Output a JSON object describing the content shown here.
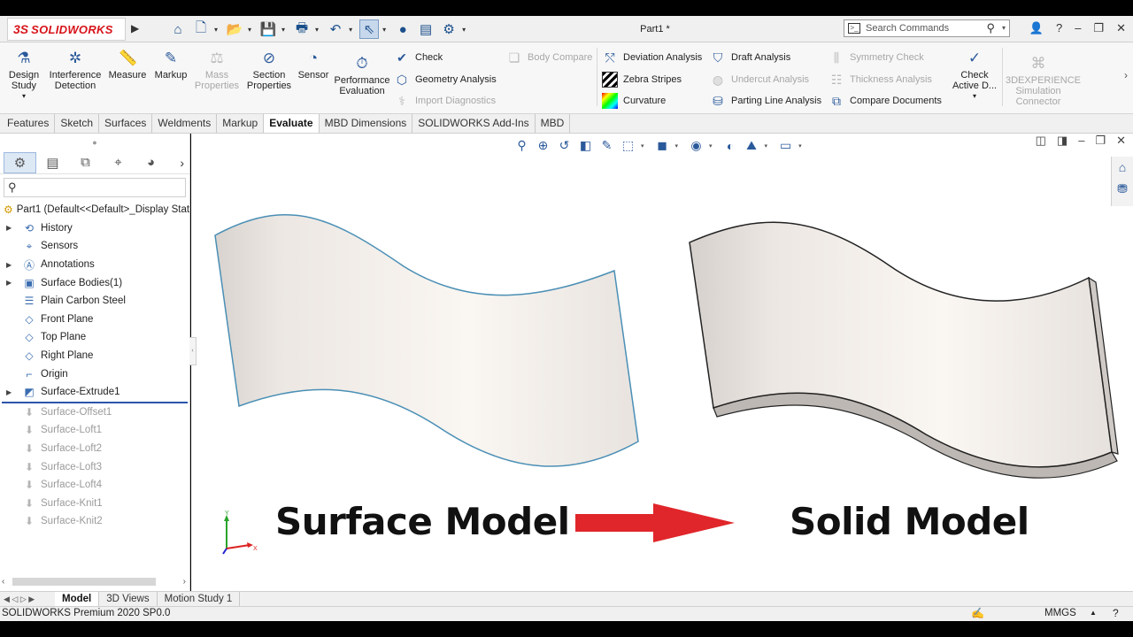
{
  "app": {
    "logo_prefix": "3S",
    "logo_text": "SOLIDWORKS",
    "document_title": "Part1 *",
    "search_placeholder": "Search Commands"
  },
  "ribbon": {
    "design_study": "Design Study",
    "interference": "Interference Detection",
    "measure": "Measure",
    "markup": "Markup",
    "mass_properties": "Mass Properties",
    "section_properties": "Section Properties",
    "sensor": "Sensor",
    "performance_evaluation": "Performance Evaluation",
    "check": "Check",
    "geometry_analysis": "Geometry Analysis",
    "import_diagnostics": "Import Diagnostics",
    "body_compare": "Body Compare",
    "deviation_analysis": "Deviation Analysis",
    "zebra_stripes": "Zebra Stripes",
    "curvature": "Curvature",
    "draft_analysis": "Draft Analysis",
    "undercut_analysis": "Undercut Analysis",
    "parting_line_analysis": "Parting Line Analysis",
    "symmetry_check": "Symmetry Check",
    "thickness_analysis": "Thickness Analysis",
    "compare_documents": "Compare Documents",
    "check_active": "Check Active D...",
    "simulation_connector": "3DEXPERIENCE Simulation Connector"
  },
  "tabs": [
    "Features",
    "Sketch",
    "Surfaces",
    "Weldments",
    "Markup",
    "Evaluate",
    "MBD Dimensions",
    "SOLIDWORKS Add-Ins",
    "MBD"
  ],
  "active_tab": "Evaluate",
  "tree": {
    "root": "Part1  (Default<<Default>_Display Stat",
    "items": [
      {
        "label": "History",
        "expandable": true
      },
      {
        "label": "Sensors",
        "expandable": false
      },
      {
        "label": "Annotations",
        "expandable": true
      },
      {
        "label": "Surface Bodies(1)",
        "expandable": true
      },
      {
        "label": "Plain Carbon Steel",
        "expandable": false
      },
      {
        "label": "Front Plane",
        "expandable": false
      },
      {
        "label": "Top Plane",
        "expandable": false
      },
      {
        "label": "Right Plane",
        "expandable": false
      },
      {
        "label": "Origin",
        "expandable": false
      },
      {
        "label": "Surface-Extrude1",
        "expandable": true
      }
    ],
    "suppressed": [
      "Surface-Offset1",
      "Surface-Loft1",
      "Surface-Loft2",
      "Surface-Loft3",
      "Surface-Loft4",
      "Surface-Knit1",
      "Surface-Knit2"
    ]
  },
  "bottom_tabs": [
    "Model",
    "3D Views",
    "Motion Study 1"
  ],
  "status": {
    "version": "SOLIDWORKS Premium 2020 SP0.0",
    "units": "MMGS"
  },
  "graphics": {
    "left_caption": "Surface Model",
    "right_caption": "Solid Model",
    "triad_x": "X",
    "triad_y": "Y",
    "arrow_color": "#e0262a",
    "surface_edge_color": "#4a8fb5",
    "surface_fill_color": "#f3eeea"
  }
}
